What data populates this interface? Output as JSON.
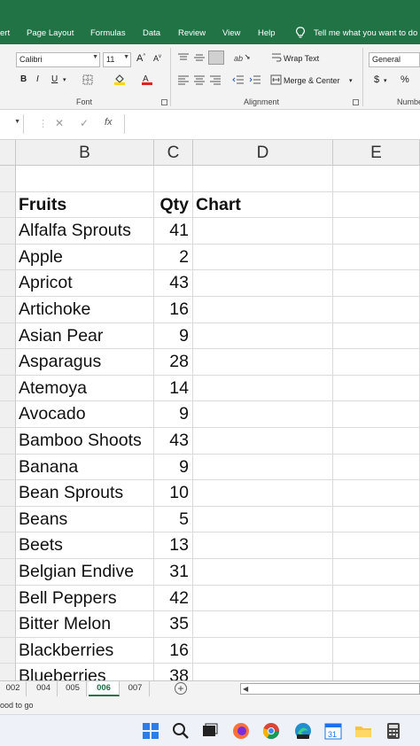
{
  "ribbon_tabs": [
    "ert",
    "Page Layout",
    "Formulas",
    "Data",
    "Review",
    "View",
    "Help",
    "Tell me what you want to do"
  ],
  "font": {
    "name": "Calibri",
    "size": "11"
  },
  "alignment": {
    "wrap_text": "Wrap Text",
    "merge_center": "Merge & Center"
  },
  "number": {
    "format": "General",
    "group_label": "Numbe"
  },
  "groups": {
    "font": "Font",
    "alignment": "Alignment"
  },
  "formula_bar": {
    "fx": "fx"
  },
  "columns": [
    "B",
    "C",
    "D",
    "E"
  ],
  "header_row": {
    "fruit": "Fruits",
    "qty": "Qty",
    "chart": "Chart"
  },
  "rows": [
    {
      "fruit": "Alfalfa Sprouts",
      "qty": "41"
    },
    {
      "fruit": "Apple",
      "qty": "2"
    },
    {
      "fruit": "Apricot",
      "qty": "43"
    },
    {
      "fruit": "Artichoke",
      "qty": "16"
    },
    {
      "fruit": "Asian Pear",
      "qty": "9"
    },
    {
      "fruit": "Asparagus",
      "qty": "28"
    },
    {
      "fruit": "Atemoya",
      "qty": "14"
    },
    {
      "fruit": "Avocado",
      "qty": "9"
    },
    {
      "fruit": "Bamboo Shoots",
      "qty": "43"
    },
    {
      "fruit": "Banana",
      "qty": "9"
    },
    {
      "fruit": "Bean Sprouts",
      "qty": "10"
    },
    {
      "fruit": "Beans",
      "qty": "5"
    },
    {
      "fruit": "Beets",
      "qty": "13"
    },
    {
      "fruit": "Belgian Endive",
      "qty": "31"
    },
    {
      "fruit": "Bell Peppers",
      "qty": "42"
    },
    {
      "fruit": "Bitter Melon",
      "qty": "35"
    },
    {
      "fruit": "Blackberries",
      "qty": "16"
    },
    {
      "fruit": "Blueberries",
      "qty": "38"
    }
  ],
  "sheet_tabs": [
    {
      "label": "002",
      "active": false
    },
    {
      "label": "004",
      "active": false
    },
    {
      "label": "005",
      "active": false
    },
    {
      "label": "006",
      "active": true
    },
    {
      "label": "007",
      "active": false
    }
  ],
  "status": "ood to go",
  "colors": {
    "ribbon_green": "#217346",
    "grid_line": "#dadada",
    "header_bg": "#f0f0f0"
  }
}
